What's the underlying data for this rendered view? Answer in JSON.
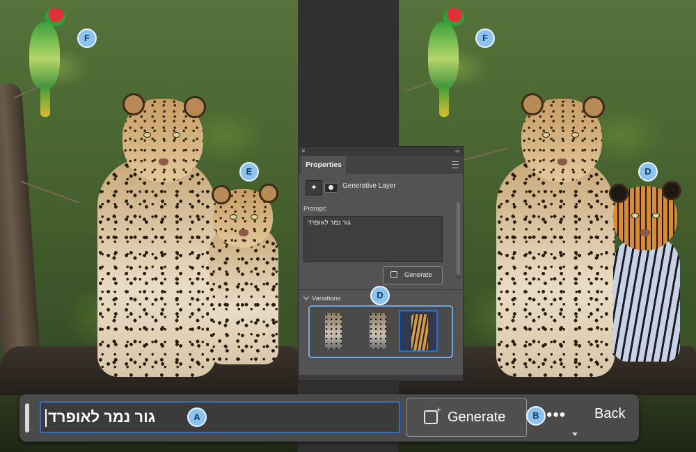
{
  "callouts": {
    "a": "A",
    "b": "B",
    "d_panel": "D",
    "d_image": "D",
    "e": "E",
    "f_left": "F",
    "f_right": "F"
  },
  "properties_panel": {
    "close_glyph": "×",
    "collapse_glyph": "‹‹",
    "tab_label": "Properties",
    "layer_name": "Generative Layer",
    "prompt_label": "Prompt:",
    "prompt_text": "גור נמר לאופרד",
    "generate_label": "Generate",
    "variations_label": "Variations"
  },
  "taskbar": {
    "prompt_value": "גור נמר לאופרד",
    "generate_label": "Generate",
    "more_label": "•••",
    "back_label": "Back"
  },
  "colors": {
    "accent_blue": "#2f6ec4",
    "callout_fill": "#8ec3ee",
    "panel_bg": "#535353",
    "taskbar_bg": "#4a4a4a"
  },
  "icons": [
    "generative-layer-icon",
    "mask-icon",
    "generate-sparkle-icon",
    "panel-menu-icon",
    "close-icon",
    "collapse-icon",
    "chevron-down-icon",
    "more-dots-icon"
  ]
}
